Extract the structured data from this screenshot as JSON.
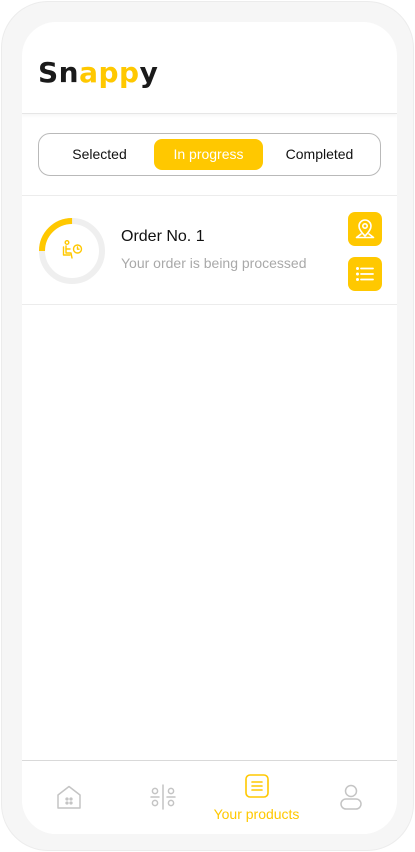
{
  "app": {
    "logo_parts": [
      "Sn",
      "app",
      "y"
    ],
    "accent_color": "#ffc800"
  },
  "tabs": [
    {
      "label": "Selected",
      "active": false
    },
    {
      "label": "In progress",
      "active": true
    },
    {
      "label": "Completed",
      "active": false
    }
  ],
  "orders": [
    {
      "title": "Order No. 1",
      "status": "Your order is being processed",
      "progress": 0.25,
      "status_icon": "seated-person-clock-icon",
      "actions": [
        "map-pin-icon",
        "list-icon"
      ]
    }
  ],
  "bottom_nav": [
    {
      "icon": "home-icon",
      "label": "",
      "active": false
    },
    {
      "icon": "catalog-icon",
      "label": "",
      "active": false
    },
    {
      "icon": "orders-icon",
      "label": "Your products",
      "active": true
    },
    {
      "icon": "profile-icon",
      "label": "",
      "active": false
    }
  ]
}
